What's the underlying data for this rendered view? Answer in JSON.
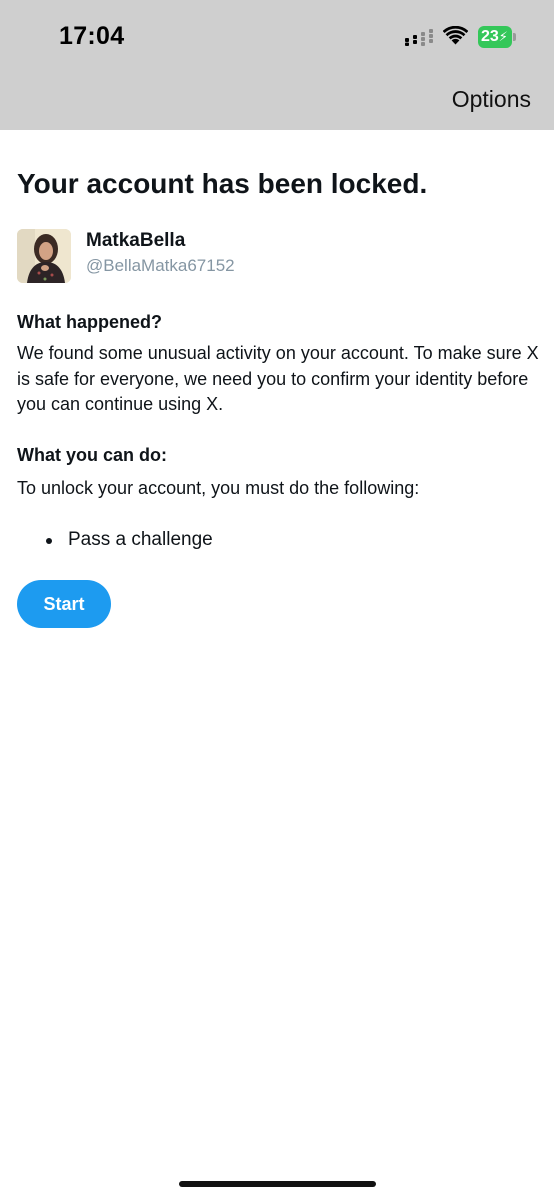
{
  "status_bar": {
    "time": "17:04",
    "battery_level": "23",
    "icons": [
      "signal-icon",
      "wifi-icon",
      "battery-charging-icon"
    ]
  },
  "header": {
    "options_label": "Options"
  },
  "page": {
    "title": "Your account has been locked."
  },
  "user": {
    "display_name": "MatkaBella",
    "handle": "@BellaMatka67152"
  },
  "what_happened": {
    "heading": "What happened?",
    "body": "We found some unusual activity on your account. To make sure X is safe for everyone, we need you to confirm your identity before you can continue using X."
  },
  "what_you_can_do": {
    "heading": "What you can do:",
    "body": "To unlock your account, you must do the following:",
    "steps": [
      "Pass a challenge"
    ]
  },
  "actions": {
    "start_label": "Start"
  },
  "colors": {
    "accent": "#1d9bf0",
    "status_bar_bg": "#cfcfcf",
    "battery_green": "#34c759",
    "handle_gray": "#8596a3"
  }
}
